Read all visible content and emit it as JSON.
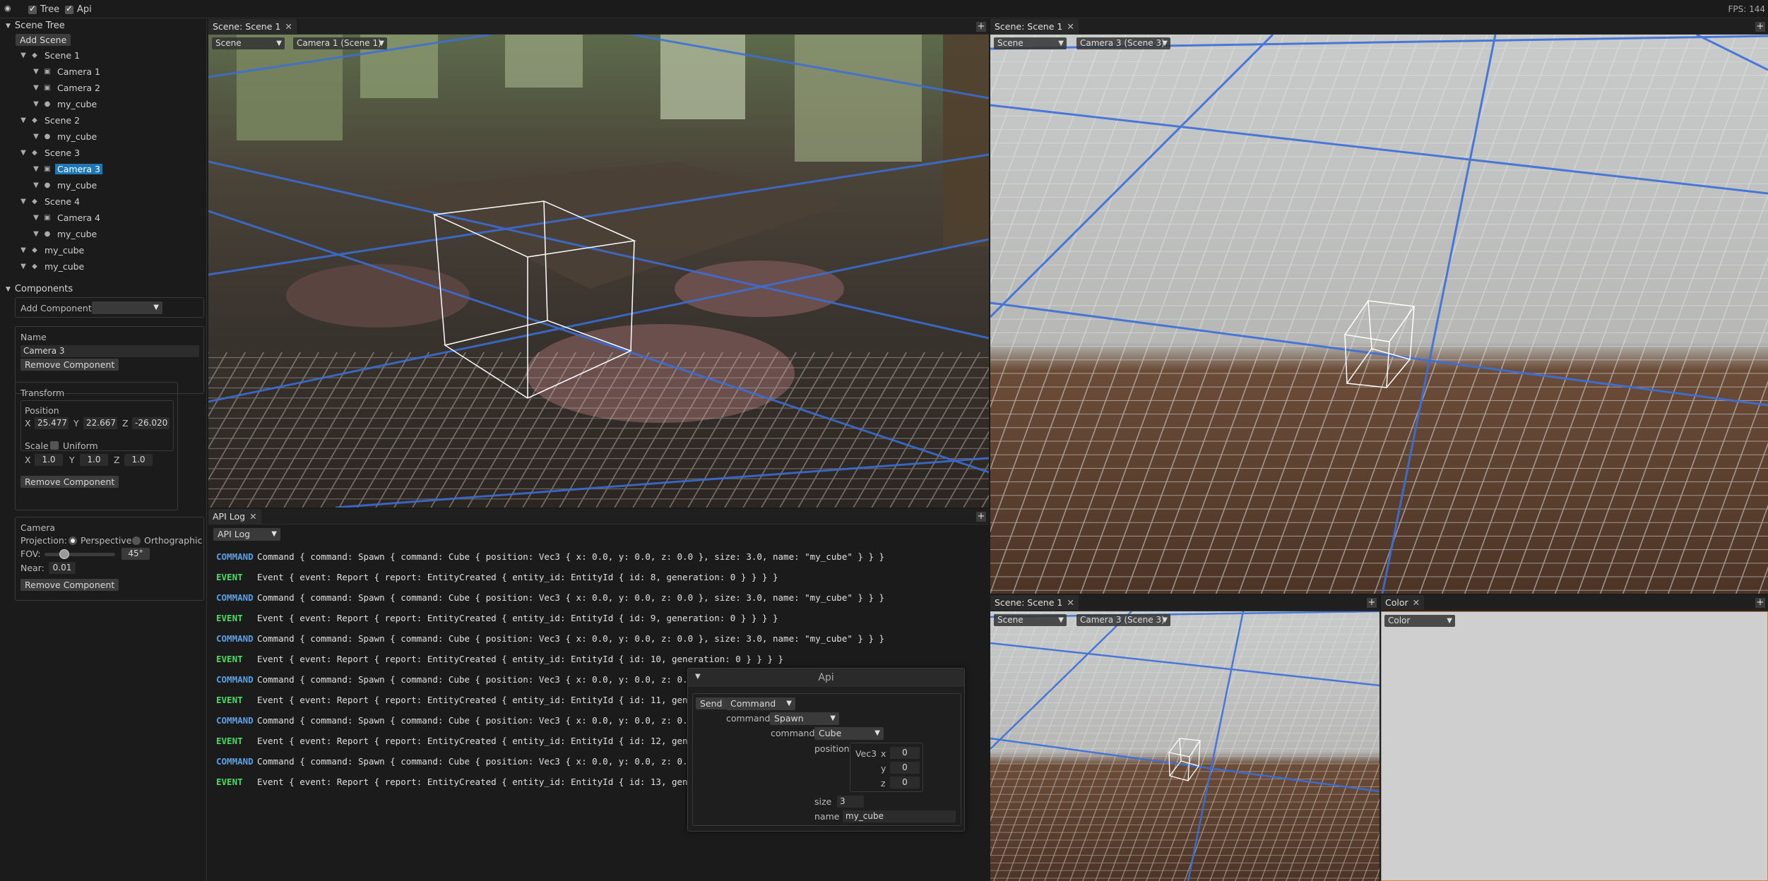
{
  "topbar": {
    "tree_label": "Tree",
    "api_label": "Api",
    "fps": "FPS: 144"
  },
  "scene_tree": {
    "title": "Scene Tree",
    "add_scene": "Add Scene",
    "items": [
      {
        "label": "Scene 1",
        "level": 1,
        "icon": "scene-icon"
      },
      {
        "label": "Camera 1",
        "level": 2,
        "icon": "camera-icon"
      },
      {
        "label": "Camera 2",
        "level": 2,
        "icon": "camera-icon"
      },
      {
        "label": "my_cube",
        "level": 2,
        "icon": "entity-icon"
      },
      {
        "label": "Scene 2",
        "level": 1,
        "icon": "scene-icon"
      },
      {
        "label": "my_cube",
        "level": 2,
        "icon": "entity-icon"
      },
      {
        "label": "Scene 3",
        "level": 1,
        "icon": "scene-icon"
      },
      {
        "label": "Camera 3",
        "level": 2,
        "icon": "camera-icon",
        "selected": true
      },
      {
        "label": "my_cube",
        "level": 2,
        "icon": "entity-icon"
      },
      {
        "label": "Scene 4",
        "level": 1,
        "icon": "scene-icon"
      },
      {
        "label": "Camera 4",
        "level": 2,
        "icon": "camera-icon"
      },
      {
        "label": "my_cube",
        "level": 2,
        "icon": "entity-icon"
      },
      {
        "label": "my_cube",
        "level": 1,
        "icon": "scene-icon"
      },
      {
        "label": "my_cube",
        "level": 1,
        "icon": "scene-icon"
      }
    ]
  },
  "components": {
    "title": "Components",
    "add_component_label": "Add Component:",
    "name": {
      "title": "Name",
      "value": "Camera 3",
      "remove": "Remove Component"
    },
    "transform": {
      "title": "Transform",
      "position_label": "Position",
      "px": "25.477",
      "py": "22.667",
      "pz": "-26.020",
      "scale_label": "Scale",
      "uniform_label": "Uniform",
      "sx": "1.0",
      "sy": "1.0",
      "sz": "1.0",
      "x": "X",
      "y": "Y",
      "z": "Z",
      "remove": "Remove Component"
    },
    "camera": {
      "title": "Camera",
      "projection_label": "Projection:",
      "perspective": "Perspective",
      "orthographic": "Orthographic",
      "fov_label": "FOV:",
      "fov_value": "45°",
      "fov_fraction": 0.28,
      "near_label": "Near:",
      "near_value": "0.01",
      "remove": "Remove Component"
    }
  },
  "views": {
    "main": {
      "tab": "Scene: Scene 1",
      "scene_dd": "Scene",
      "camera_dd": "Camera 1 (Scene 1)"
    },
    "right_top": {
      "tab": "Scene: Scene 1",
      "scene_dd": "Scene",
      "camera_dd": "Camera 3 (Scene 3)"
    },
    "right_bottom": {
      "tab": "Scene: Scene 1",
      "scene_dd": "Scene",
      "camera_dd": "Camera 3 (Scene 3)"
    },
    "color": {
      "tab": "Color",
      "dd": "Color"
    }
  },
  "api_log": {
    "tab": "API Log",
    "dd": "API Log",
    "rows": [
      {
        "kind": "COMMAND",
        "text": "Command { command: Spawn { command: Cube { position: Vec3 { x: 0.0, y: 0.0, z: 0.0 }, size: 3.0, name: \"my_cube\" } } }"
      },
      {
        "kind": "EVENT",
        "text": "Event { event: Report { report: EntityCreated { entity_id: EntityId { id: 8, generation: 0 } } } }"
      },
      {
        "kind": "COMMAND",
        "text": "Command { command: Spawn { command: Cube { position: Vec3 { x: 0.0, y: 0.0, z: 0.0 }, size: 3.0, name: \"my_cube\" } } }"
      },
      {
        "kind": "EVENT",
        "text": "Event { event: Report { report: EntityCreated { entity_id: EntityId { id: 9, generation: 0 } } } }"
      },
      {
        "kind": "COMMAND",
        "text": "Command { command: Spawn { command: Cube { position: Vec3 { x: 0.0, y: 0.0, z: 0.0 }, size: 3.0, name: \"my_cube\" } } }"
      },
      {
        "kind": "EVENT",
        "text": "Event { event: Report { report: EntityCreated { entity_id: EntityId { id: 10, generation: 0 } } } }"
      },
      {
        "kind": "COMMAND",
        "text": "Command { command: Spawn { command: Cube { position: Vec3 { x: 0.0, y: 0.0, z: 0.0 }, s"
      },
      {
        "kind": "EVENT",
        "text": "Event { event: Report { report: EntityCreated { entity_id: EntityId { id: 11, generatio"
      },
      {
        "kind": "COMMAND",
        "text": "Command { command: Spawn { command: Cube { position: Vec3 { x: 0.0, y: 0.0, z: 0.0 }, s"
      },
      {
        "kind": "EVENT",
        "text": "Event { event: Report { report: EntityCreated { entity_id: EntityId { id: 12, generatio"
      },
      {
        "kind": "COMMAND",
        "text": "Command { command: Spawn { command: Cube { position: Vec3 { x: 0.0, y: 0.0, z: 0.0 }, s"
      },
      {
        "kind": "EVENT",
        "text": "Event { event: Report { report: EntityCreated { entity_id: EntityId { id: 13, generatio"
      }
    ]
  },
  "api_window": {
    "title": "Api",
    "send": "Send",
    "type_dd": "Command",
    "command_label": "command",
    "command_dd": "Spawn",
    "command2_label": "command",
    "command2_dd": "Cube",
    "position_label": "position",
    "vec3_label": "Vec3",
    "x_label": "x",
    "x_value": "0",
    "y_label": "y",
    "y_value": "0",
    "z_label": "z",
    "z_value": "0",
    "size_label": "size",
    "size_value": "3",
    "name_label": "name",
    "name_value": "my_cube"
  },
  "colors": {
    "accent": "#1f77b4",
    "command": "#5aa0e6",
    "event": "#4cd964",
    "grid": "#3b6fd9"
  }
}
